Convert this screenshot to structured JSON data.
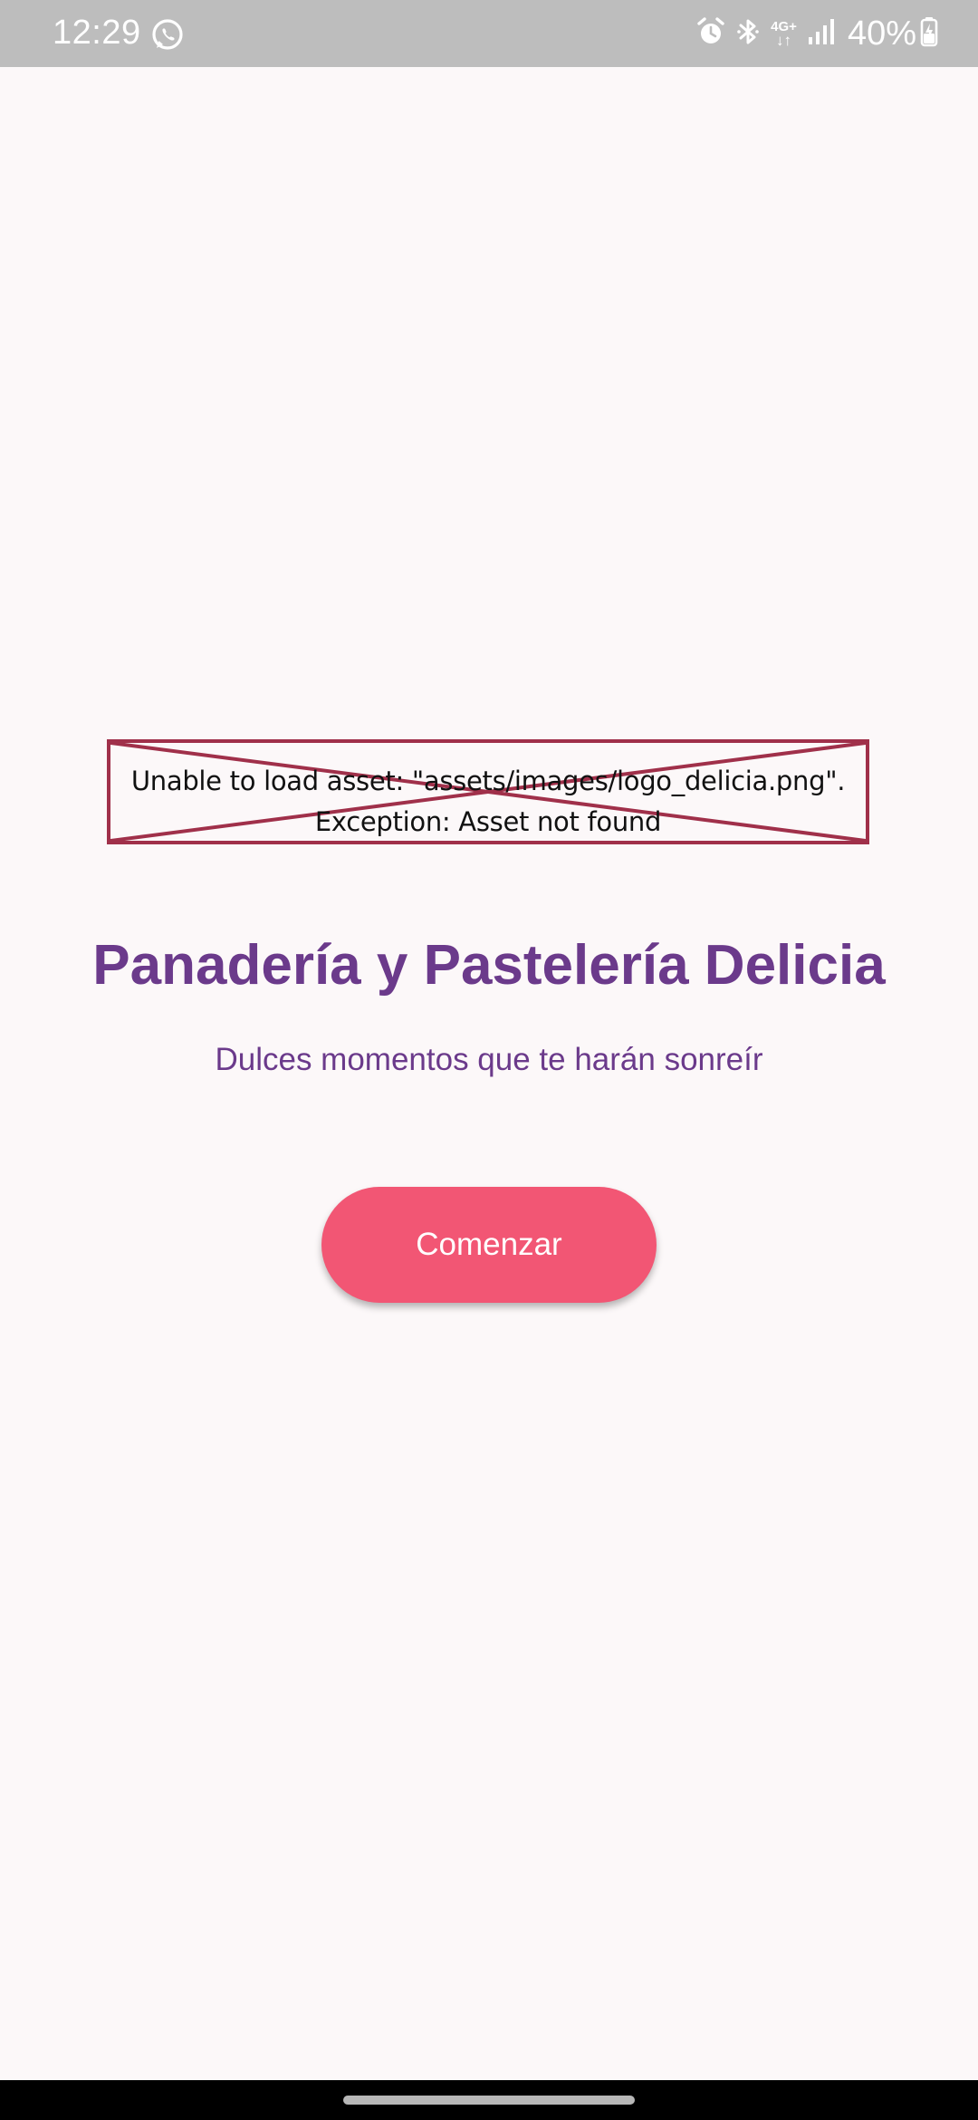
{
  "status_bar": {
    "time": "12:29",
    "network_top": "4G+",
    "network_bottom": "↓↑",
    "battery_percent": "40%",
    "icons": [
      "whatsapp-icon",
      "alarm-icon",
      "bluetooth-icon",
      "signal-icon",
      "battery-icon"
    ]
  },
  "image_error": {
    "line1": "Unable to load asset: \"assets/images/logo_delicia.png\".",
    "line2": "Exception: Asset not found"
  },
  "main": {
    "title": "Panadería y Pastelería Delicia",
    "subtitle": "Dulces momentos que te harán sonreír",
    "start_button_label": "Comenzar"
  },
  "colors": {
    "background": "#fcf8f9",
    "title": "#6b3a8b",
    "button": "#f25674",
    "error_border": "#a0304a",
    "status_bar": "#bdbdbd"
  }
}
